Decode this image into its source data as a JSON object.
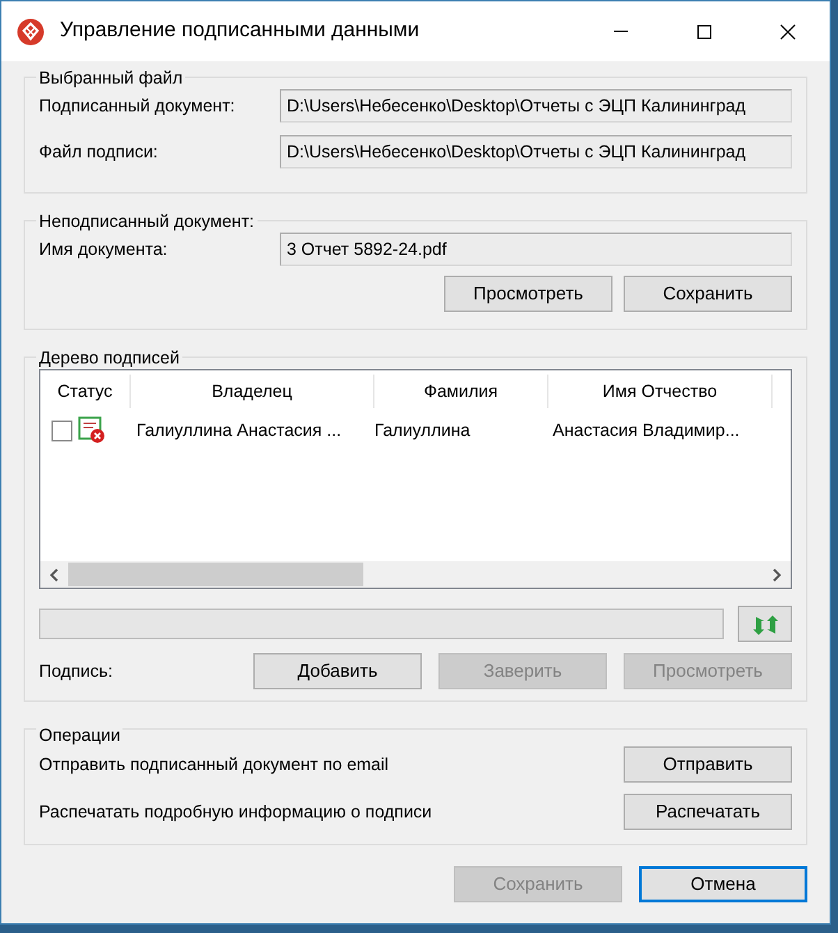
{
  "window": {
    "title": "Управление подписанными данными"
  },
  "selected_file": {
    "legend": "Выбранный файл",
    "rows": [
      {
        "label": "Подписанный документ:",
        "value": "D:\\Users\\Небесенко\\Desktop\\Отчеты с ЭЦП Калининград"
      },
      {
        "label": "Файл подписи:",
        "value": "D:\\Users\\Небесенко\\Desktop\\Отчеты с ЭЦП Калининград"
      }
    ]
  },
  "unsigned_document": {
    "legend": "Неподписанный документ:",
    "label": "Имя документа:",
    "value": "3 Отчет 5892-24.pdf",
    "buttons": [
      {
        "label": "Просмотреть",
        "disabled": false
      },
      {
        "label": "Сохранить",
        "disabled": false
      }
    ]
  },
  "signature_tree": {
    "legend": "Дерево подписей",
    "columns": [
      "Статус",
      "Владелец",
      "Фамилия",
      "Имя Отчество"
    ],
    "rows": [
      {
        "checked": false,
        "cells": [
          "",
          "Галиуллина Анастасия ...",
          "Галиуллина",
          "Анастасия Владимир..."
        ]
      }
    ],
    "signature_label": "Подпись:",
    "buttons": [
      {
        "label": "Добавить",
        "disabled": false
      },
      {
        "label": "Заверить",
        "disabled": true
      },
      {
        "label": "Просмотреть",
        "disabled": true
      }
    ]
  },
  "operations": {
    "legend": "Операции",
    "items": [
      {
        "text": "Отправить подписанный документ по email",
        "button": "Отправить"
      },
      {
        "text": "Распечатать подробную информацию о подписи",
        "button": "Распечатать"
      }
    ]
  },
  "footer_buttons": [
    {
      "label": "Сохранить",
      "disabled": true,
      "default": false
    },
    {
      "label": "Отмена",
      "disabled": false,
      "default": true
    }
  ]
}
